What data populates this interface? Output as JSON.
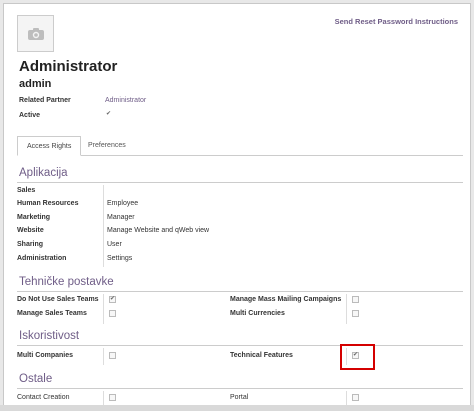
{
  "header": {
    "reset_link": "Send Reset Password Instructions",
    "title": "Administrator",
    "login": "admin"
  },
  "fields": {
    "related_partner_label": "Related Partner",
    "related_partner_value": "Administrator",
    "active_label": "Active",
    "active_checked": true
  },
  "tabs": [
    {
      "label": "Access Rights",
      "active": true
    },
    {
      "label": "Preferences",
      "active": false
    }
  ],
  "sections": {
    "apps": {
      "title": "Aplikacija",
      "rows": [
        {
          "label": "Sales",
          "value": ""
        },
        {
          "label": "Human Resources",
          "value": "Employee"
        },
        {
          "label": "Marketing",
          "value": "Manager"
        },
        {
          "label": "Website",
          "value": "Manage Website and qWeb view"
        },
        {
          "label": "Sharing",
          "value": "User"
        },
        {
          "label": "Administration",
          "value": "Settings"
        }
      ]
    },
    "technical": {
      "title": "Tehničke postavke",
      "left": [
        {
          "label": "Do Not Use Sales Teams",
          "checked": true
        },
        {
          "label": "Manage Sales Teams",
          "checked": false
        }
      ],
      "right": [
        {
          "label": "Manage Mass Mailing Campaigns",
          "checked": false
        },
        {
          "label": "Multi Currencies",
          "checked": false
        }
      ]
    },
    "usability": {
      "title": "Iskoristivost",
      "left": [
        {
          "label": "Multi Companies",
          "checked": false
        }
      ],
      "right": [
        {
          "label": "Technical Features",
          "checked": true
        }
      ]
    },
    "other": {
      "title": "Ostale",
      "left": [
        {
          "label": "Contact Creation",
          "checked": false
        }
      ],
      "right": [
        {
          "label": "Portal",
          "checked": false
        }
      ]
    }
  },
  "icons": {
    "avatar": "camera-icon",
    "checkmark": "✔"
  },
  "colors": {
    "accent": "#6f5d87",
    "highlight": "#d40000"
  }
}
